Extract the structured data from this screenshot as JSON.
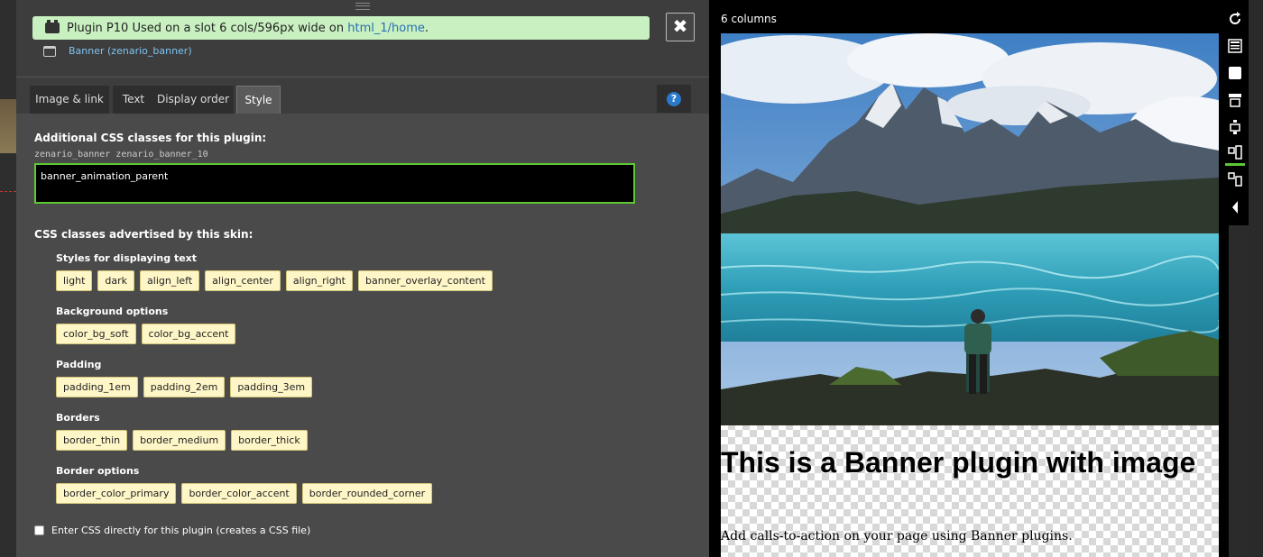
{
  "header": {
    "plugin_code": "Plugin P10",
    "info_text": "Used on a slot 6 cols/596px wide on ",
    "info_link": "html_1/home",
    "info_suffix": ".",
    "banner_link": "Banner (zenario_banner)"
  },
  "tabs": [
    {
      "label": "Image & link"
    },
    {
      "label": "Text"
    },
    {
      "label": "Display order"
    },
    {
      "label": "Style"
    }
  ],
  "active_tab": "Style",
  "help_label": "?",
  "close_label": "✖",
  "form": {
    "css_classes_label": "Additional CSS classes for this plugin:",
    "css_classes_hint": "zenario_banner zenario_banner_10",
    "css_classes_value": "banner_animation_parent",
    "advertised_label": "CSS classes advertised by this skin:",
    "groups": [
      {
        "title": "Styles for displaying text",
        "chips": [
          "light",
          "dark",
          "align_left",
          "align_center",
          "align_right",
          "banner_overlay_content"
        ]
      },
      {
        "title": "Background options",
        "chips": [
          "color_bg_soft",
          "color_bg_accent"
        ]
      },
      {
        "title": "Padding",
        "chips": [
          "padding_1em",
          "padding_2em",
          "padding_3em"
        ]
      },
      {
        "title": "Borders",
        "chips": [
          "border_thin",
          "border_medium",
          "border_thick"
        ]
      },
      {
        "title": "Border options",
        "chips": [
          "border_color_primary",
          "border_color_accent",
          "border_rounded_corner"
        ]
      }
    ],
    "direct_css_label": "Enter CSS directly for this plugin (creates a CSS file)",
    "direct_css_checked": false
  },
  "preview": {
    "columns_label": "6 columns",
    "banner_title": "This is a Banner plugin with image",
    "banner_text": "Add calls-to-action on your page using Banner plugins."
  },
  "toolbar": {
    "icons": [
      "refresh-icon",
      "page-icon",
      "square-icon",
      "slot-top-icon",
      "slot-middle-icon",
      "slot-split-icon",
      "slot-move-icon",
      "collapse-left-icon"
    ],
    "active": "slot-split-icon"
  },
  "colors": {
    "info_bar": "#c8f0c0",
    "input_border": "#5ec832",
    "chip_bg": "#fff6c8",
    "link": "#7ec3f0",
    "help": "#2a78c8"
  }
}
